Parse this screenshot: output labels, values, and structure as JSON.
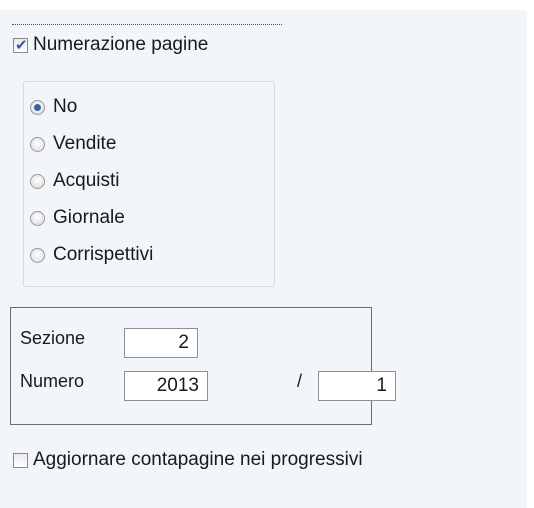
{
  "numerazione": {
    "label": "Numerazione pagine",
    "checked": true
  },
  "radios": [
    {
      "label": "No",
      "selected": true
    },
    {
      "label": "Vendite",
      "selected": false
    },
    {
      "label": "Acquisti",
      "selected": false
    },
    {
      "label": "Giornale",
      "selected": false
    },
    {
      "label": "Corrispettivi",
      "selected": false
    }
  ],
  "fields": {
    "sezione_label": "Sezione",
    "sezione_value": "2",
    "numero_label": "Numero",
    "numero_value": "2013",
    "separator": "/",
    "numero2_value": "1"
  },
  "aggiornare": {
    "label": "Aggiornare contapagine nei progressivi",
    "checked": false
  }
}
